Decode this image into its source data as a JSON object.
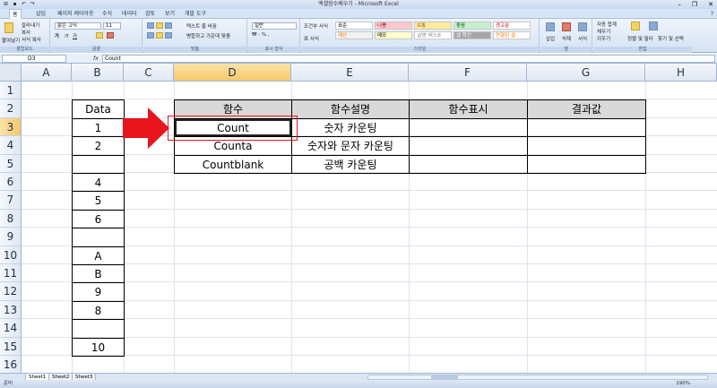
{
  "window": {
    "title": "엑셀함수배우기 - Microsoft Excel",
    "controls": [
      "–",
      "❐",
      "✕"
    ]
  },
  "ribbon_tabs": [
    "홈",
    "삽입",
    "페이지 레이아웃",
    "수식",
    "데이터",
    "검토",
    "보기",
    "개발 도구"
  ],
  "ribbon": {
    "clipboard": {
      "paste": "붙여넣기",
      "cut": "잘라내기",
      "copy": "복사",
      "format_painter": "서식 복사",
      "label": "클립보드"
    },
    "font": {
      "name": "맑은 고딕",
      "size": "11",
      "label": "글꼴"
    },
    "alignment": {
      "wrap": "텍스트 줄 바꿈",
      "merge": "병합하고 가운데 맞춤",
      "label": "맞춤"
    },
    "number": {
      "format": "일반",
      "label": "표시 형식"
    },
    "styles": {
      "conditional": "조건부 서식",
      "table": "표 서식",
      "cells": [
        "표준",
        "나쁨",
        "보통",
        "좋음",
        "경고문",
        "계산",
        "메모",
        "설명 텍스트",
        "셀 확인",
        "연결된 셀"
      ],
      "label": "스타일"
    },
    "cells_group": {
      "insert": "삽입",
      "delete": "삭제",
      "format": "서식",
      "label": "셀"
    },
    "editing": {
      "autosum": "자동 합계",
      "fill": "채우기",
      "clear": "지우기",
      "sort": "정렬 및 필터",
      "find": "찾기 및 선택",
      "label": "편집"
    }
  },
  "formula_bar": {
    "name_box": "D3",
    "fx": "fx",
    "formula": "Count"
  },
  "columns": [
    "A",
    "B",
    "C",
    "D",
    "E",
    "F",
    "G",
    "H"
  ],
  "rows": [
    "1",
    "2",
    "3",
    "4",
    "5",
    "6",
    "7",
    "8",
    "9",
    "10",
    "11",
    "12",
    "13",
    "14",
    "15",
    "16",
    "17"
  ],
  "data_column": {
    "header": "Data",
    "values": [
      "1",
      "2",
      "",
      "4",
      "5",
      "6",
      "",
      "A",
      "B",
      "9",
      "8",
      "",
      "10"
    ]
  },
  "func_table": {
    "headers": [
      "함수",
      "함수설명",
      "함수표시",
      "결과값"
    ],
    "rows": [
      [
        "Count",
        "숫자 카운팅",
        "",
        ""
      ],
      [
        "Counta",
        "숫자와 문자 카운팅",
        "",
        ""
      ],
      [
        "Countblank",
        "공백 카운팅",
        "",
        ""
      ]
    ]
  },
  "sheets": [
    "Sheet1",
    "Sheet2",
    "Sheet3"
  ],
  "status": {
    "ready": "준비",
    "zoom": "190%"
  },
  "colors": {
    "arrow": "#e8141e",
    "highlight_box": "#e8141e",
    "header_fill": "#d9d9d9"
  }
}
